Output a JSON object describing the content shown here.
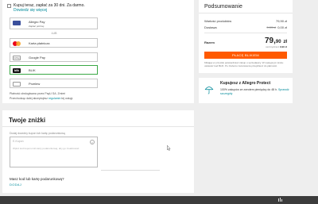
{
  "payment": {
    "bnpl_text": "Kupuj teraz, zapłać za 30 dni. Za darmo.",
    "bnpl_link": "Dowiedz się więcej",
    "options": {
      "allegro": {
        "label": "Allegro Pay",
        "sub": "Zapłać później"
      },
      "or_label": "LUB",
      "card": {
        "label": "Karta płatnicza"
      },
      "gpay": {
        "label": "Google Pay",
        "icon": "GPay"
      },
      "blik": {
        "label": "BLIK",
        "icon": "blik"
      },
      "przelew": {
        "label": "Przelew"
      }
    },
    "footnote1": "Płatność obsługiwana przez PayU SA. Zmień",
    "footnote2_pre": "Przechodząc dalej akceptujesz ",
    "footnote2_link": "regulamin",
    "footnote2_post": " tej usługi."
  },
  "discounts": {
    "title": "Twoje zniżki",
    "label": "Dodaj dowolny kupon lub kartę podarunkową",
    "placeholder": "E-Kupon",
    "placeholder_note": "Wpisz kod kuponu lub karty podarunkowej, aby go zrealizować",
    "clear_icon": "×",
    "gift_question": "Masz kod lub kartę podarunkową?",
    "gift_link": "DODAJ"
  },
  "summary": {
    "title": "Podsumowanie",
    "products_label": "Wartość produktów",
    "products_value": "79,90 zł",
    "shipping_label": "Dostawa",
    "shipping_old": "9,99 zł",
    "shipping_value": "0,00 zł",
    "total_label": "Razem",
    "total_main": "79,",
    "total_cents": "90",
    "total_currency": "zł",
    "savings_label": "oszczędzasz",
    "savings_value": "9,99 zł",
    "pay_button": "PŁACĘ BLIKIEM",
    "terms": "Klikając w przycisk potwierdzasz zakup u sprzedawcy. W następnym kroku ustawisz kod BLIK. Po złożeniu zamówienia przejdziesz do płatności."
  },
  "protect": {
    "title": "Kupujesz z Allegro Protect",
    "text_pre": "100% zakupów ze zwrotem pieniędzy do 48 h. ",
    "text_link": "Sprawdź szczegóły"
  },
  "colors": {
    "accent": "#ff5a00",
    "link": "#008a9a",
    "selected": "#3aa845"
  }
}
